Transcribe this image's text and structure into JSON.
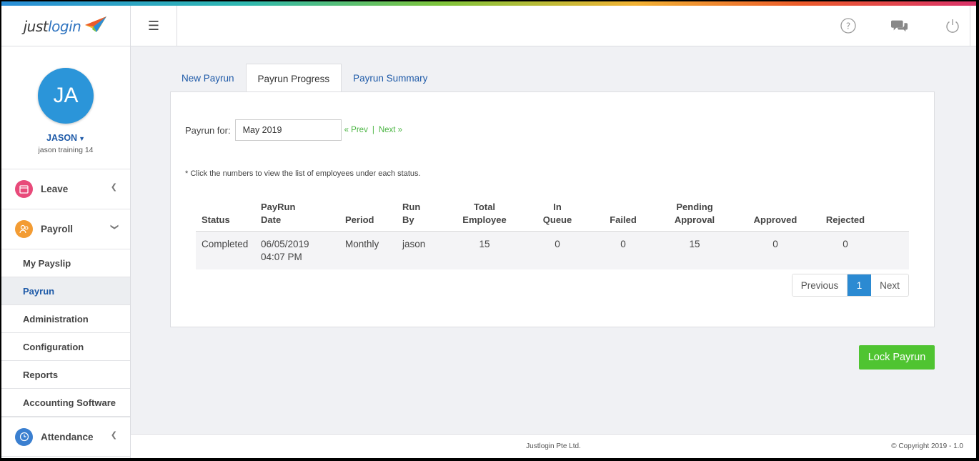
{
  "brand": {
    "logo_text_main": "just",
    "logo_text_accent": "login"
  },
  "colors": {
    "primary": "#1e5aa8",
    "accent_blue": "#2b95d9",
    "success": "#4fc431",
    "pending": "#f0a33a"
  },
  "header": {
    "icons": [
      "menu-icon",
      "help-icon",
      "chat-icon",
      "power-icon"
    ]
  },
  "user": {
    "initials": "JA",
    "name": "JASON",
    "subtitle": "jason training 14"
  },
  "sidebar": {
    "leave": "Leave",
    "payroll": "Payroll",
    "sub_items": [
      "My Payslip",
      "Payrun",
      "Administration",
      "Configuration",
      "Reports",
      "Accounting Software"
    ],
    "attendance": "Attendance"
  },
  "tabs": [
    "New Payrun",
    "Payrun Progress",
    "Payrun Summary"
  ],
  "filter": {
    "label": "Payrun for:",
    "value": "May 2019",
    "prev": "« Prev",
    "next": "Next »",
    "sep": "|"
  },
  "note": "* Click the numbers to view the list of employees under each status.",
  "table": {
    "headers": [
      [
        "Status"
      ],
      [
        "PayRun",
        "Date"
      ],
      [
        "Period"
      ],
      [
        "Run",
        "By"
      ],
      [
        "Total",
        "Employee"
      ],
      [
        "In",
        "Queue"
      ],
      [
        "Failed"
      ],
      [
        "Pending",
        "Approval"
      ],
      [
        "Approved"
      ],
      [
        "Rejected"
      ]
    ],
    "row": {
      "status": "Completed",
      "date": "06/05/2019",
      "time": "04:07 PM",
      "period": "Monthly",
      "run_by": "jason",
      "total": "15",
      "in_queue": "0",
      "failed": "0",
      "pending": "15",
      "approved": "0",
      "rejected": "0"
    }
  },
  "pager": {
    "prev": "Previous",
    "current": "1",
    "next": "Next"
  },
  "lock_button": "Lock Payrun",
  "footer": {
    "company": "Justlogin Pte Ltd.",
    "copyright": "© Copyright 2019 - 1.0"
  }
}
